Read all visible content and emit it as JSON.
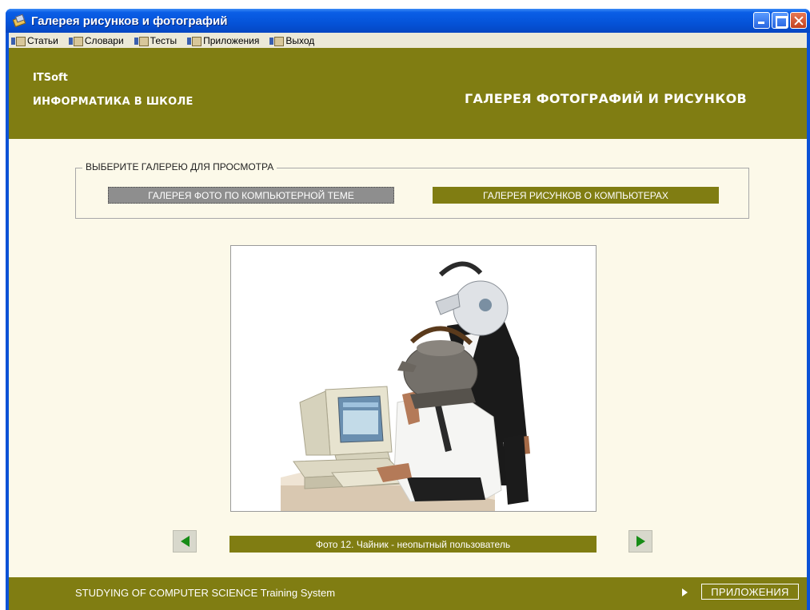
{
  "window": {
    "title": "Галерея рисунков и фотографий"
  },
  "menu": [
    {
      "label": "Статьи"
    },
    {
      "label": "Словари"
    },
    {
      "label": "Тесты"
    },
    {
      "label": "Приложения"
    },
    {
      "label": "Выход"
    }
  ],
  "header": {
    "brand": "ITSoft",
    "subtitle": "ИНФОРМАТИКА В ШКОЛЕ",
    "title": "ГАЛЕРЕЯ ФОТОГРАФИЙ И РИСУНКОВ"
  },
  "selector": {
    "legend": "ВЫБЕРИТЕ ГАЛЕРЕЮ ДЛЯ ПРОСМОТРА",
    "photo_gallery": "ГАЛЕРЕЯ ФОТО ПО КОМПЬЮТЕРНОЙ ТЕМЕ",
    "drawing_gallery": "ГАЛЕРЕЯ РИСУНКОВ О КОМПЬЮТЕРАХ"
  },
  "viewer": {
    "caption": "Фото 12. Чайник - неопытный пользователь"
  },
  "footer": {
    "text": "STUDYING OF COMPUTER SCIENCE Training System",
    "button": "ПРИЛОЖЕНИЯ"
  },
  "colors": {
    "olive": "#807d12",
    "background": "#fcf9e9",
    "selected_button": "#8e8e8e",
    "arrow_green": "#178c17"
  },
  "icons": {
    "prev": "arrow-left-icon",
    "next": "arrow-right-icon",
    "footer_arrow": "triangle-right-icon"
  }
}
